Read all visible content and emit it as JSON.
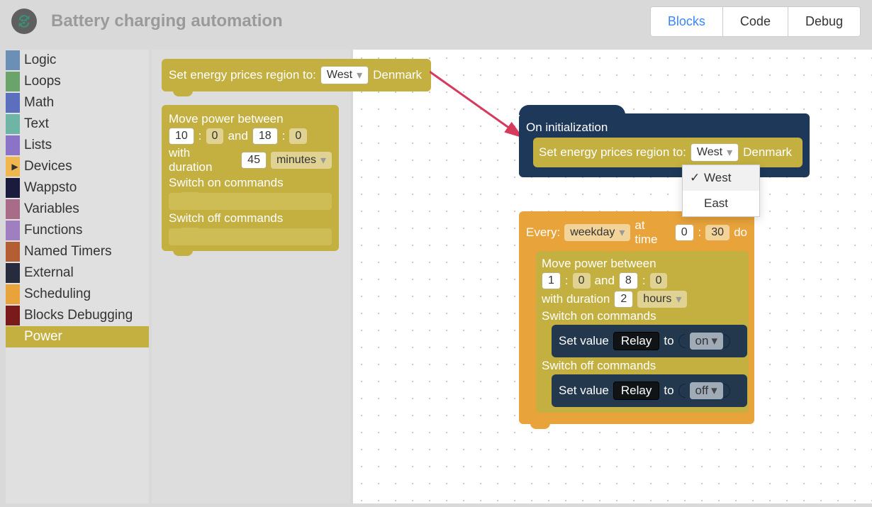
{
  "header": {
    "title": "Battery charging automation",
    "tabs": {
      "blocks": "Blocks",
      "code": "Code",
      "debug": "Debug"
    }
  },
  "toolbox": {
    "items": [
      {
        "label": "Logic",
        "color": "#6b8fb5"
      },
      {
        "label": "Loops",
        "color": "#6ba46b"
      },
      {
        "label": "Math",
        "color": "#5c6fbf"
      },
      {
        "label": "Text",
        "color": "#6fb5a6"
      },
      {
        "label": "Lists",
        "color": "#8b73c8"
      },
      {
        "label": "Devices",
        "color": "#f0b64f",
        "arrow": true
      },
      {
        "label": "Wappsto",
        "color": "#1b1b3e"
      },
      {
        "label": "Variables",
        "color": "#a86b88"
      },
      {
        "label": "Functions",
        "color": "#a07fc0"
      },
      {
        "label": "Named Timers",
        "color": "#b35f33"
      },
      {
        "label": "External",
        "color": "#262b3d"
      },
      {
        "label": "Scheduling",
        "color": "#e9a33b"
      },
      {
        "label": "Blocks Debugging",
        "color": "#7a1a1a"
      },
      {
        "label": "Power",
        "color": "#c3b040",
        "selected": true
      }
    ]
  },
  "palette": {
    "setRegion": {
      "prefix": "Set energy prices region to:",
      "value": "West",
      "suffix": "Denmark"
    },
    "movePower": {
      "title": "Move power between",
      "t1h": "10",
      "t1m": "0",
      "and": "and",
      "t2h": "18",
      "t2m": "0",
      "dur_label": "with duration",
      "dur_val": "45",
      "dur_unit": "minutes",
      "on_label": "Switch on commands",
      "off_label": "Switch off commands"
    }
  },
  "ws": {
    "onInit": {
      "title": "On initialization",
      "setRegion": {
        "prefix": "Set energy prices region to:",
        "value": "West",
        "suffix": "Denmark"
      }
    },
    "dropdown": {
      "opt1": "West",
      "opt2": "East"
    },
    "schedule": {
      "every": "Every:",
      "weekday": "weekday",
      "atTime": "at time",
      "h": "0",
      "m": "30",
      "do": "do"
    },
    "movePower": {
      "title": "Move power between",
      "t1h": "1",
      "t1m": "0",
      "and": "and",
      "t2h": "8",
      "t2m": "0",
      "dur_label": "with duration",
      "dur_val": "2",
      "dur_unit": "hours",
      "on_label": "Switch on commands",
      "off_label": "Switch off commands"
    },
    "setValue": {
      "label": "Set value",
      "chip": "Relay",
      "to": "to",
      "on": "on",
      "off": "off"
    }
  }
}
